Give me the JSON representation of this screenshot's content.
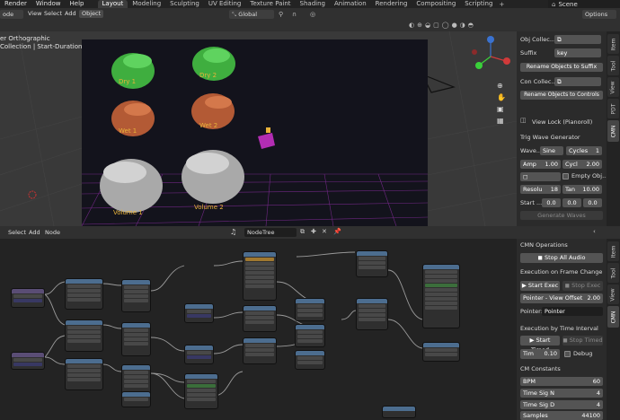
{
  "topbar": {
    "menus": [
      "Render",
      "Window",
      "Help"
    ],
    "workspaces": [
      "Layout",
      "Modeling",
      "Sculpting",
      "UV Editing",
      "Texture Paint",
      "Shading",
      "Animation",
      "Rendering",
      "Compositing",
      "Scripting"
    ],
    "active_workspace": "Layout",
    "scene": "Scene"
  },
  "viewport_header": {
    "mode": "ode",
    "menus": [
      "View",
      "Select",
      "Add",
      "Object"
    ],
    "orientation": "Global",
    "options": "Options",
    "overlay_line1": "er Orthographic",
    "overlay_line2": "Collection | Start-Duration 1"
  },
  "scene_labels": {
    "dry1": "Dry 1",
    "dry2": "Dry 2",
    "wet1": "Wet 1",
    "wet2": "Wet 2",
    "vol1": "Volume 1",
    "vol2": "Volume 2"
  },
  "npanel": {
    "obj_collection": "Obj Collec...",
    "suffix_label": "Suffix",
    "suffix_value": "key",
    "rename_suffix": "Rename Objects to Suffix",
    "con_collection": "Con Collec...",
    "rename_controls": "Rename Objects to Controls",
    "view_lock": "View Lock (Pianoroll)",
    "trig_header": "Trig Wave Generator",
    "wave_label": "Wave...",
    "wave_value": "Sine",
    "cycles": "Cycles",
    "cycles_value": "1",
    "amp": "Amp",
    "amp_value": "1.00",
    "cycl": "Cycl",
    "cycl_value": "2.00",
    "empty_obj": "Empty Obj...",
    "resolu": "Resolu",
    "resolu_value": "18",
    "tan": "Tan",
    "tan_value": "10.00",
    "start": "Start ...",
    "start_v1": "0.0",
    "start_v2": "0.0",
    "start_v3": "0.0",
    "generate": "Generate Waves",
    "tabs": [
      "Item",
      "Tool",
      "View",
      "PDT",
      "CMN"
    ]
  },
  "node_header": {
    "menus": [
      "Select",
      "Add",
      "Node"
    ],
    "tree": "NodeTree"
  },
  "ne_panel": {
    "cmn_ops": "CMN Operations",
    "stop_audio": "Stop All Audio",
    "frame_change": "Execution on Frame Change",
    "start_exec": "Start Exec",
    "stop_exec": "Stop Exec",
    "pointer_offset": "Pointer - View Offset",
    "pointer_offset_val": "2.00",
    "pointer_label": "Pointer:",
    "pointer_val": "Pointer",
    "timed_header": "Execution by Time Interval",
    "start_timed": "Start Timed",
    "stop_timed": "Stop Timed",
    "tim": "Tim",
    "tim_val": "0.10",
    "debug": "Debug",
    "constants": "CM Constants",
    "bpm": "BPM",
    "bpm_val": "60",
    "tsn": "Time Sig N",
    "tsn_val": "4",
    "tsd": "Time Sig D",
    "tsd_val": "4",
    "samples": "Samples",
    "samples_val": "44100",
    "tabs": [
      "Item",
      "Tool",
      "View",
      "CMN"
    ]
  },
  "colors": {
    "accent": "#4772b3",
    "green": "#3db53d",
    "copper": "#c0663e",
    "grey": "#bdbdbd",
    "label_yellow": "#e8b23a",
    "purple": "#b32db3"
  }
}
